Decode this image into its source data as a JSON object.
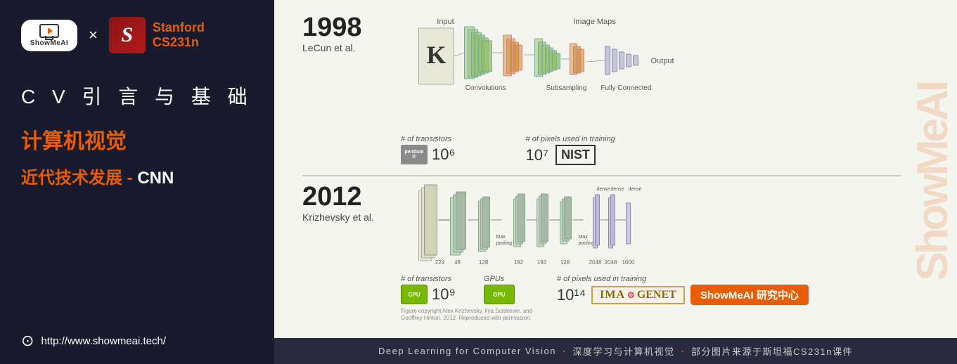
{
  "sidebar": {
    "showmeai_label": "ShowMeAI",
    "x_label": "×",
    "stanford_line1": "Stanford",
    "stanford_line2": "CS231n",
    "cv_title": "C V 引 言 与 基 础",
    "course_title": "计算机视觉",
    "lesson_title_part1": "近代技术发展",
    "lesson_title_dash": " - ",
    "lesson_title_part2": "CNN",
    "website": "http://www.showmeai.tech/"
  },
  "content": {
    "section1998": {
      "year": "1998",
      "author": "LeCun et al.",
      "labels": {
        "input": "Input",
        "image_maps": "Image Maps",
        "convolutions": "Convolutions",
        "subsampling": "Subsampling",
        "fully_connected": "Fully Connected",
        "output": "Output"
      },
      "stats": {
        "transistors_label": "# of transistors",
        "transistors_value": "10⁶",
        "pixels_label": "# of pixels used in training",
        "pixels_value": "10⁷",
        "chip_name": "pentium",
        "dataset_name": "NIST"
      }
    },
    "section2012": {
      "year": "2012",
      "author": "Krizhevsky et al.",
      "stats": {
        "transistors_label": "# of transistors",
        "transistors_value": "10⁹",
        "gpus_label": "GPUs",
        "pixels_label": "# of pixels used in training",
        "pixels_value": "10¹⁴",
        "dataset_name": "ImageNet"
      },
      "copyright": "Figure copyright Alex Krizhevsky, Ilya Sutskever, and Geoffrey Hinton, 2012. Reproduced with permission."
    }
  },
  "footer": {
    "text1": "Deep Learning for Computer Vision",
    "dot1": "·",
    "text2": "深度学习与计算机视觉",
    "dot2": "·",
    "text3": "部分图片来源于斯坦福CS231n课件"
  },
  "watermark": {
    "text": "ShowMeAI"
  },
  "brand_badge": {
    "label": "ShowMeAI 研究中心"
  }
}
